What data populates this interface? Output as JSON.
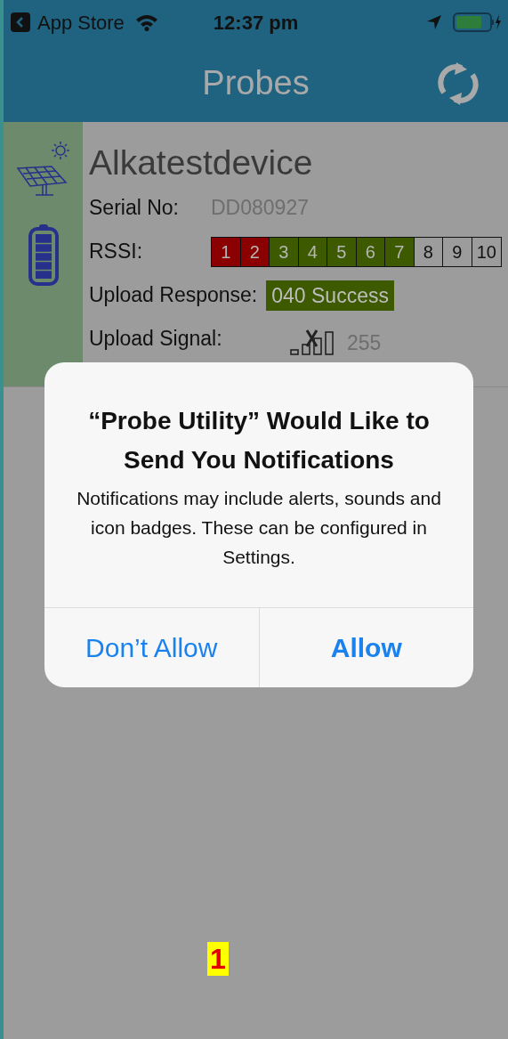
{
  "status_bar": {
    "back_label": "App Store",
    "time": "12:37 pm"
  },
  "nav": {
    "title": "Probes"
  },
  "probe": {
    "name": "Alkatestdevice",
    "serial_label": "Serial No:",
    "serial": "DD080927",
    "rssi_label": "RSSI:",
    "rssi_cells": [
      {
        "label": "1",
        "color": "#8b0000"
      },
      {
        "label": "2",
        "color": "#8b0000"
      },
      {
        "label": "3",
        "color": "#3d5a00"
      },
      {
        "label": "4",
        "color": "#3d5a00"
      },
      {
        "label": "5",
        "color": "#3d5a00"
      },
      {
        "label": "6",
        "color": "#3d5a00"
      },
      {
        "label": "7",
        "color": "#3d5a00"
      },
      {
        "label": "8",
        "color": "#9c9c9c"
      },
      {
        "label": "9",
        "color": "#9c9c9c"
      },
      {
        "label": "10",
        "color": "#9c9c9c"
      }
    ],
    "upload_response_label": "Upload Response:",
    "upload_response": "040 Success",
    "upload_signal_label": "Upload Signal:",
    "upload_signal_value": "255"
  },
  "alert": {
    "title": "“Probe Utility” Would Like to Send You Notifications",
    "message": "Notifications may include alerts, sounds and icon badges. These can be configured in Settings.",
    "buttons": [
      {
        "label": "Don’t Allow",
        "kind": "cancel"
      },
      {
        "label": "Allow",
        "kind": "default"
      }
    ]
  },
  "annotation": {
    "label": "1"
  }
}
